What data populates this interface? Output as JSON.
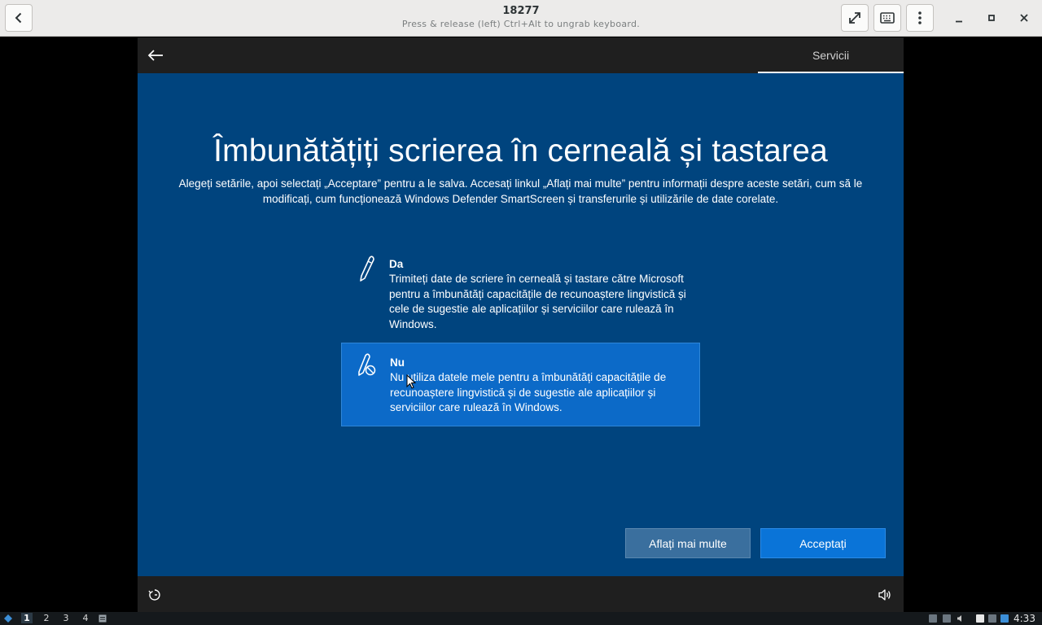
{
  "viewer": {
    "title": "18277",
    "subtitle": "Press & release (left) Ctrl+Alt to ungrab keyboard."
  },
  "vm": {
    "tab_label": "Servicii",
    "title": "Îmbunătățiți scrierea în cerneală și tastarea",
    "description": "Alegeți setările, apoi selectați „Acceptare” pentru a le salva. Accesați linkul „Aflați mai multe” pentru informații despre aceste setări, cum să le modificați, cum funcționează Windows Defender SmartScreen și transferurile și utilizările de date corelate.",
    "options": [
      {
        "name": "Da",
        "text": "Trimiteți date de scriere în cerneală și tastare către Microsoft pentru a îmbunătăți capacitățile de recunoaștere lingvistică și cele de sugestie ale aplicațiilor și serviciilor care rulează în Windows.",
        "icon": "pen-icon",
        "selected": false
      },
      {
        "name": "Nu",
        "text": "Nu utiliza datele mele pentru a îmbunătăți capacitățile de recunoaștere lingvistică și de sugestie ale aplicațiilor și serviciilor care rulează în Windows.",
        "icon": "pen-blocked-icon",
        "selected": true
      }
    ],
    "learn_more_label": "Aflați mai multe",
    "accept_label": "Acceptați"
  },
  "taskbar": {
    "workspaces": [
      "1",
      "2",
      "3",
      "4"
    ],
    "active_workspace": "1",
    "clock": "4:33"
  },
  "colors": {
    "vm_background": "#00447e",
    "selected_option": "#0c6ac8",
    "accept_button": "#0a74d8",
    "learn_button": "#3a6f9e"
  }
}
